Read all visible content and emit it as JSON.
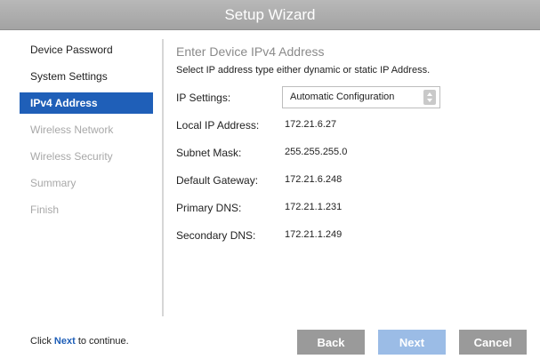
{
  "window": {
    "title": "Setup Wizard"
  },
  "sidebar": {
    "items": [
      {
        "label": "Device Password",
        "state": "normal"
      },
      {
        "label": "System Settings",
        "state": "normal"
      },
      {
        "label": "IPv4 Address",
        "state": "active"
      },
      {
        "label": "Wireless Network",
        "state": "disabled"
      },
      {
        "label": "Wireless Security",
        "state": "disabled"
      },
      {
        "label": "Summary",
        "state": "disabled"
      },
      {
        "label": "Finish",
        "state": "disabled"
      }
    ]
  },
  "main": {
    "title": "Enter Device IPv4 Address",
    "description": "Select IP address type either dynamic or static IP Address.",
    "ip_settings": {
      "label": "IP Settings:",
      "value": "Automatic Configuration"
    },
    "fields": [
      {
        "label": "Local IP Address:",
        "value": "172.21.6.27"
      },
      {
        "label": "Subnet Mask:",
        "value": "255.255.255.0"
      },
      {
        "label": "Default Gateway:",
        "value": "172.21.6.248"
      },
      {
        "label": "Primary DNS:",
        "value": "172.21.1.231"
      },
      {
        "label": "Secondary DNS:",
        "value": "172.21.1.249"
      }
    ]
  },
  "footer": {
    "hint_prefix": "Click",
    "hint_highlight": "Next",
    "hint_suffix": "to continue.",
    "back_label": "Back",
    "next_label": "Next",
    "cancel_label": "Cancel"
  },
  "colors": {
    "accent": "#1f5fb8",
    "titlebar": "#a3a3a3",
    "button_gray": "#9a9a9a",
    "button_next": "#9bbce6",
    "disabled_text": "#a8a8a8"
  }
}
